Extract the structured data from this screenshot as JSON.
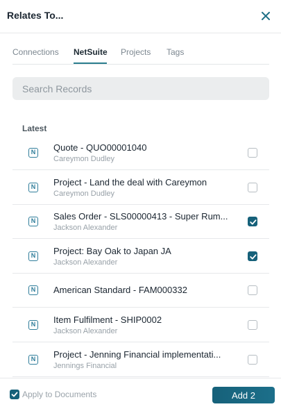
{
  "header": {
    "title": "Relates To..."
  },
  "tabs": [
    {
      "label": "Connections"
    },
    {
      "label": "NetSuite"
    },
    {
      "label": "Projects"
    },
    {
      "label": "Tags"
    }
  ],
  "search": {
    "placeholder": "Search Records"
  },
  "section": {
    "label": "Latest"
  },
  "records": [
    {
      "icon": "N",
      "name": "Quote - QUO00001040",
      "sub": "Careymon Dudley",
      "checked": false
    },
    {
      "icon": "N",
      "name": "Project - Land the deal with Careymon",
      "sub": "Careymon Dudley",
      "checked": false
    },
    {
      "icon": "N",
      "name": "Sales Order - SLS00000413 - Super Rum...",
      "sub": "Jackson Alexander",
      "checked": true
    },
    {
      "icon": "N",
      "name": "Project: Bay Oak to Japan JA",
      "sub": "Jackson Alexander",
      "checked": true
    },
    {
      "icon": "N",
      "name": "American Standard - FAM000332",
      "sub": "",
      "checked": false
    },
    {
      "icon": "N",
      "name": "Item Fulfilment - SHIP0002",
      "sub": "Jackson Alexander",
      "checked": false
    },
    {
      "icon": "N",
      "name": "Project - Jenning Financial implementati...",
      "sub": "Jennings Financial",
      "checked": false
    }
  ],
  "footer": {
    "apply_label": "Apply to Documents",
    "apply_checked": true,
    "add_label": "Add 2"
  },
  "colors": {
    "accent": "#16617a",
    "tab_underline": "#2a7d8e"
  }
}
